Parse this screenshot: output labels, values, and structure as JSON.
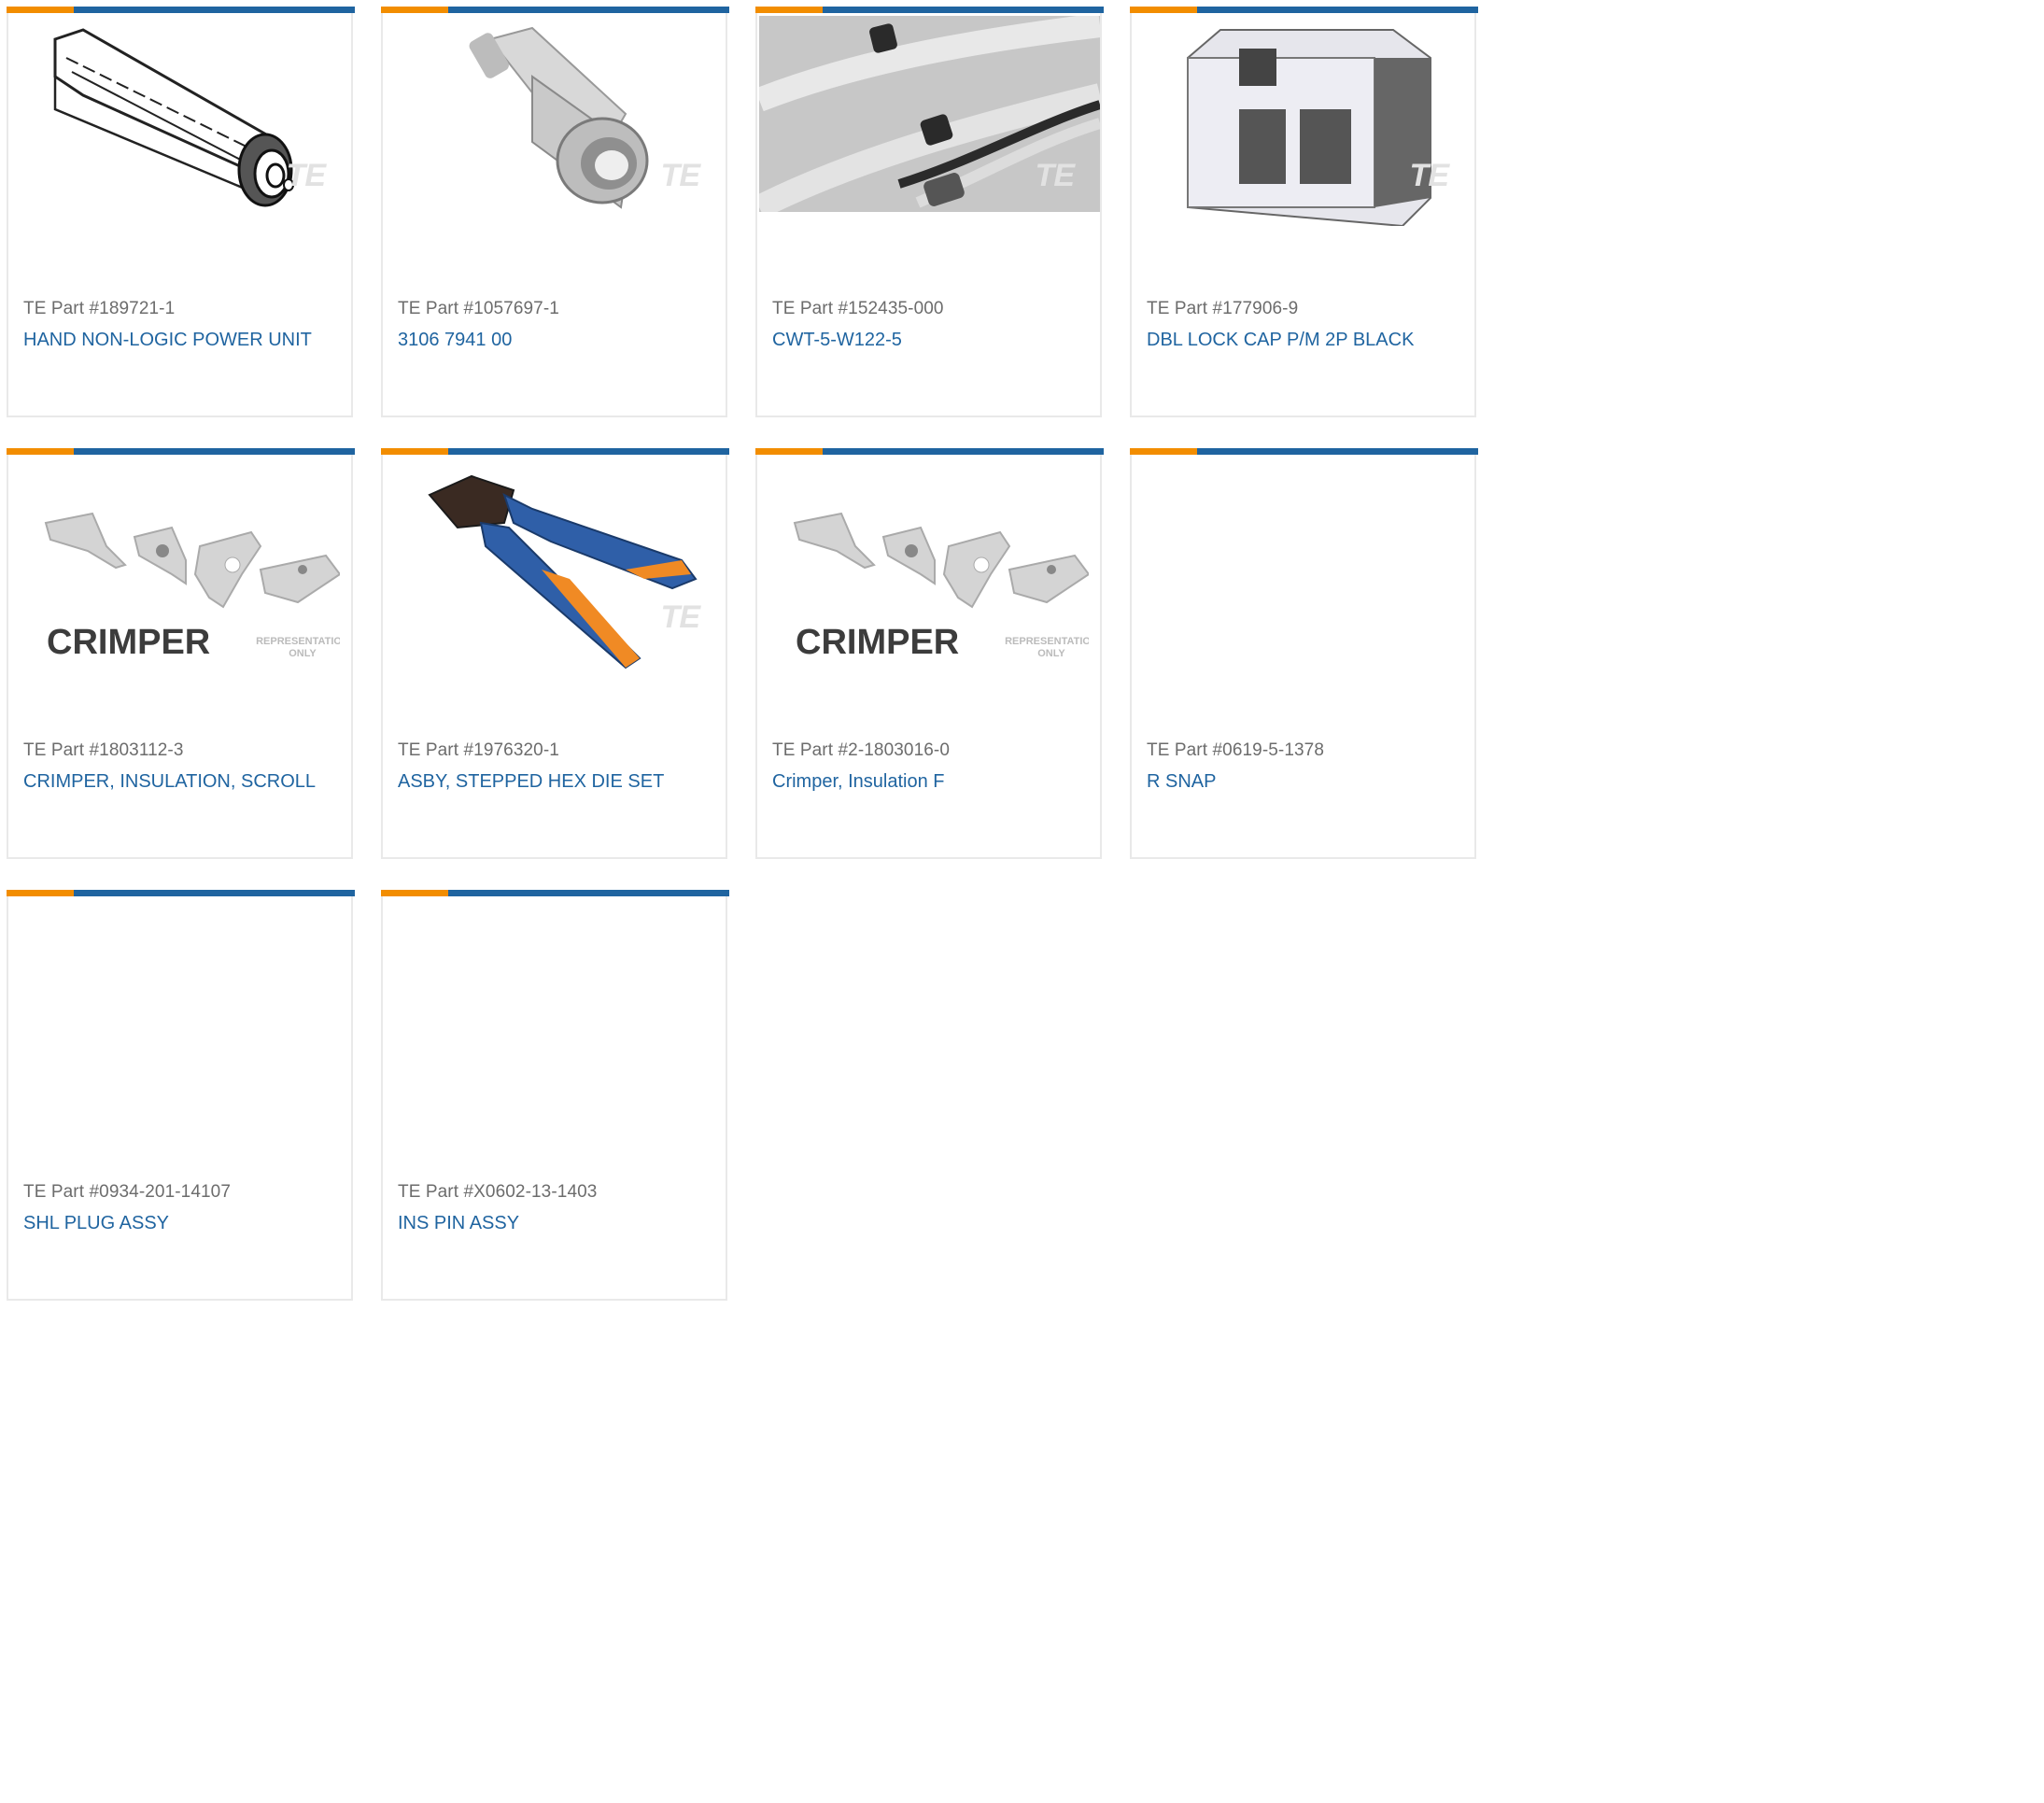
{
  "accent": {
    "orange": "#f28d00",
    "blue": "#1f64a0"
  },
  "cards": [
    {
      "part": "TE Part #189721-1",
      "name": "HAND NON-LOGIC POWER UNIT",
      "icon": "power-unit-image"
    },
    {
      "part": "TE Part #1057697-1",
      "name": "3106 7941 00",
      "icon": "rf-connector-image"
    },
    {
      "part": "TE Part #152435-000",
      "name": "CWT-5-W122-5",
      "icon": "cable-photo-image"
    },
    {
      "part": "TE Part #177906-9",
      "name": "DBL LOCK CAP P/M 2P BLACK",
      "icon": "connector-housing-image"
    },
    {
      "part": "TE Part #1803112-3",
      "name": "CRIMPER, INSULATION, SCROLL",
      "icon": "crimper-image",
      "crimper_text": "CRIMPER",
      "rep_line1": "REPRESENTATION",
      "rep_line2": "ONLY"
    },
    {
      "part": "TE Part #1976320-1",
      "name": "ASBY, STEPPED HEX DIE SET",
      "icon": "crimp-tool-image"
    },
    {
      "part": "TE Part #2-1803016-0",
      "name": "Crimper, Insulation F",
      "icon": "crimper-image",
      "crimper_text": "CRIMPER",
      "rep_line1": "REPRESENTATION",
      "rep_line2": "ONLY"
    },
    {
      "part": "TE Part #0619-5-1378",
      "name": "R SNAP",
      "icon": ""
    },
    {
      "part": "TE Part #0934-201-14107",
      "name": "SHL PLUG ASSY",
      "icon": ""
    },
    {
      "part": "TE Part #X0602-13-1403",
      "name": "INS PIN ASSY",
      "icon": ""
    }
  ],
  "watermark": "TE"
}
